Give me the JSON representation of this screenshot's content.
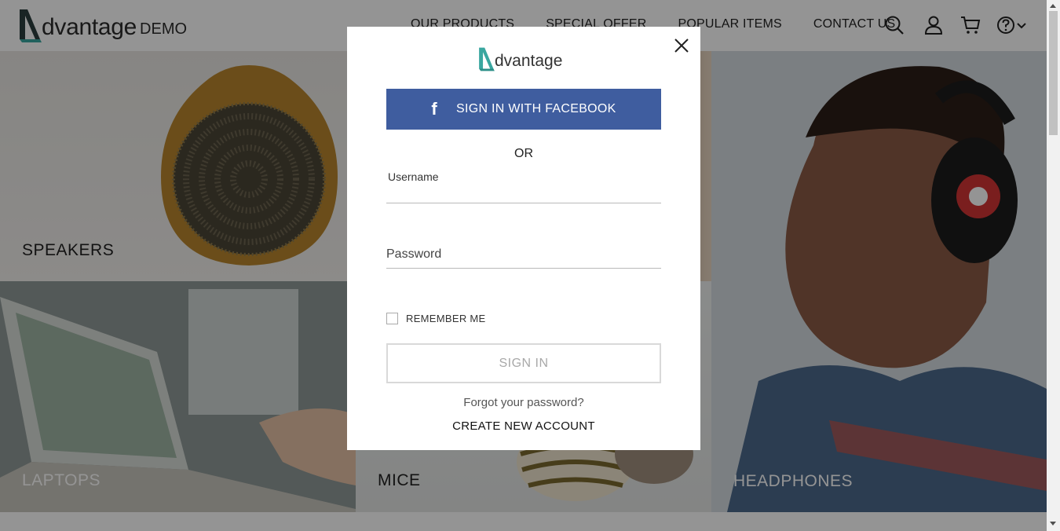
{
  "header": {
    "logo_text": "dvantage",
    "logo_suffix": "DEMO",
    "nav": [
      "OUR PRODUCTS",
      "SPECIAL OFFER",
      "POPULAR ITEMS",
      "CONTACT US"
    ],
    "icons": [
      "search-icon",
      "user-icon",
      "cart-icon",
      "help-icon",
      "chevron-down-icon"
    ]
  },
  "categories": [
    {
      "label": "SPEAKERS"
    },
    {
      "label": "LAPTOPS"
    },
    {
      "label": "MICE"
    },
    {
      "label": "HEADPHONES"
    }
  ],
  "modal": {
    "logo_text": "dvantage",
    "facebook_label": "SIGN IN WITH FACEBOOK",
    "facebook_icon": "f",
    "or_label": "OR",
    "username_label": "Username",
    "username_value": "",
    "password_label": "Password",
    "password_value": "",
    "remember_label": "REMEMBER ME",
    "remember_checked": false,
    "signin_label": "SIGN IN",
    "forgot_label": "Forgot your password?",
    "create_label": "CREATE NEW ACCOUNT"
  },
  "colors": {
    "brand_teal": "#2fa2a0",
    "facebook_blue": "#3f5d9f",
    "overlay": "rgba(0,0,0,0.42)"
  }
}
